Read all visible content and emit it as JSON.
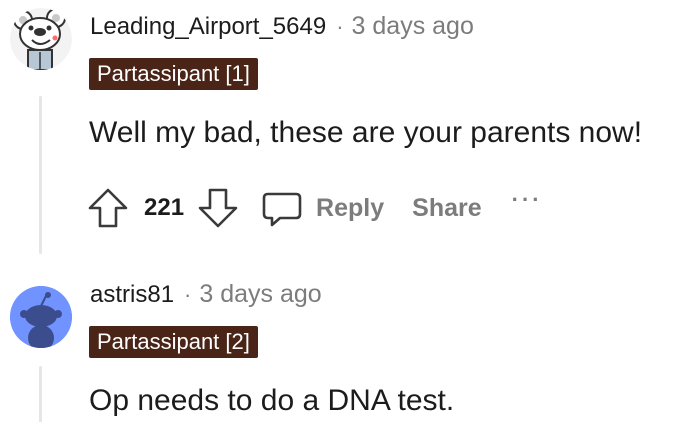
{
  "comments": [
    {
      "username": "Leading_Airport_5649",
      "separator": "·",
      "timestamp": "3 days ago",
      "flair": "Partassipant [1]",
      "body": "Well my bad, these are your parents now!",
      "score": "221",
      "actions": {
        "reply": "Reply",
        "share": "Share",
        "more": "···"
      },
      "avatar_icon": "koala-avatar-icon"
    },
    {
      "username": "astris81",
      "separator": "·",
      "timestamp": "3 days ago",
      "flair": "Partassipant [2]",
      "body": "Op needs to do a DNA test.",
      "avatar_icon": "snoo-default-avatar-icon"
    }
  ],
  "colors": {
    "flair_bg": "#4a2517",
    "muted_text": "#7c7c7c",
    "thread_line": "#e6e6e6",
    "avatar2_bg": "#7193ff"
  }
}
